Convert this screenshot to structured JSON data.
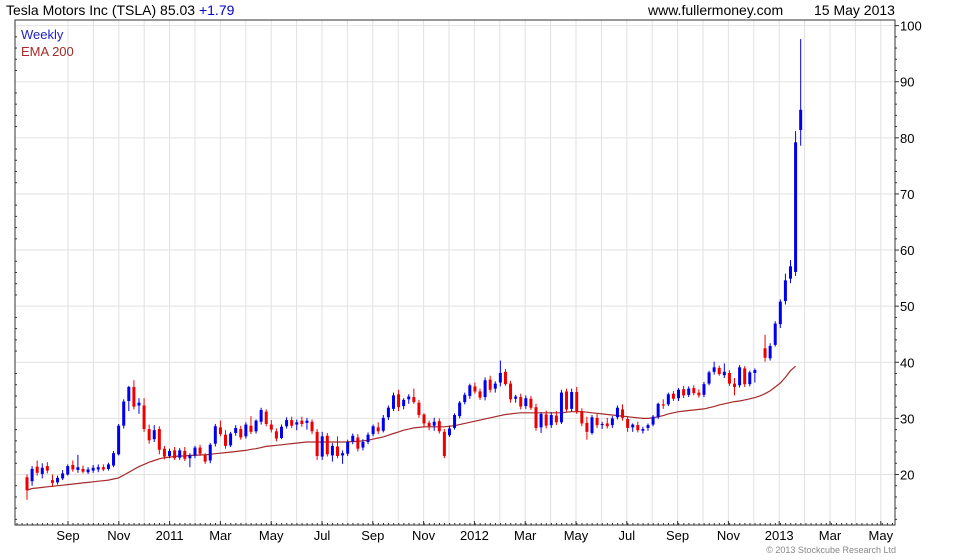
{
  "header": {
    "title": "Tesla Motors Inc (TSLA) 85.03",
    "change": "+1.79",
    "site": "www.fullermoney.com",
    "date": "15 May 2013"
  },
  "legend": {
    "period": "Weekly",
    "period_color": "#1f1fbf",
    "ema": "EMA 200",
    "ema_color": "#a52a2a"
  },
  "credit": "© 2013 Stockcube Research Ltd",
  "colors": {
    "up": "#0000ee",
    "down": "#ee0000",
    "ema": "#a52a2a",
    "grid": "#e2e2e2",
    "frame": "#333333"
  },
  "chart_data": {
    "type": "candlestick",
    "period": "weekly",
    "y_axis_side": "right",
    "ylim": [
      11,
      101
    ],
    "yticks": [
      20,
      30,
      40,
      50,
      60,
      70,
      80,
      90,
      100
    ],
    "grid": true,
    "legend_position": "top-left",
    "x_tick_labels": [
      "Sep",
      "Nov",
      "2011",
      "Mar",
      "May",
      "Jul",
      "Sep",
      "Nov",
      "2012",
      "Mar",
      "May",
      "Jul",
      "Sep",
      "Nov",
      "2013",
      "Mar",
      "May"
    ],
    "series": [
      {
        "name": "Weekly",
        "columns": [
          "open",
          "high",
          "low",
          "close"
        ],
        "values": [
          [
            19.5,
            20.0,
            15.5,
            17.2
          ],
          [
            18.8,
            21.5,
            18.0,
            21.0
          ],
          [
            21.4,
            22.5,
            19.8,
            20.3
          ],
          [
            20.1,
            22.0,
            19.3,
            21.2
          ],
          [
            21.5,
            22.2,
            20.2,
            20.7
          ],
          [
            19.0,
            20.0,
            17.8,
            18.5
          ],
          [
            18.6,
            19.8,
            18.2,
            19.4
          ],
          [
            19.3,
            20.8,
            19.0,
            20.2
          ],
          [
            20.0,
            21.8,
            19.8,
            21.5
          ],
          [
            21.7,
            22.5,
            20.5,
            20.9
          ],
          [
            20.8,
            23.5,
            20.3,
            21.3
          ],
          [
            21.0,
            21.6,
            20.2,
            20.5
          ],
          [
            20.4,
            21.3,
            20.1,
            20.9
          ],
          [
            20.7,
            21.7,
            20.3,
            21.2
          ],
          [
            20.9,
            21.8,
            20.4,
            21.3
          ],
          [
            21.3,
            21.8,
            20.6,
            20.9
          ],
          [
            21.0,
            22.1,
            20.7,
            21.8
          ],
          [
            21.6,
            24.2,
            21.3,
            23.8
          ],
          [
            23.6,
            29.0,
            23.4,
            28.7
          ],
          [
            28.7,
            33.4,
            28.2,
            33.0
          ],
          [
            33.1,
            35.8,
            31.3,
            35.6
          ],
          [
            35.6,
            36.8,
            31.6,
            32.1
          ],
          [
            32.3,
            33.6,
            30.8,
            32.8
          ],
          [
            32.3,
            33.6,
            27.6,
            28.1
          ],
          [
            28.1,
            28.9,
            25.5,
            26.1
          ],
          [
            26.3,
            28.8,
            25.8,
            27.9
          ],
          [
            28.1,
            28.6,
            23.6,
            24.4
          ],
          [
            24.6,
            25.1,
            22.7,
            23.2
          ],
          [
            23.3,
            24.6,
            22.9,
            24.2
          ],
          [
            24.3,
            24.9,
            22.6,
            22.9
          ],
          [
            23.0,
            24.7,
            22.6,
            24.3
          ],
          [
            24.2,
            24.9,
            22.4,
            22.8
          ],
          [
            22.9,
            23.8,
            21.3,
            23.4
          ],
          [
            23.4,
            25.1,
            22.9,
            24.8
          ],
          [
            24.8,
            25.3,
            23.3,
            23.7
          ],
          [
            23.4,
            23.8,
            21.9,
            22.3
          ],
          [
            22.5,
            25.6,
            22.0,
            25.3
          ],
          [
            25.5,
            29.0,
            25.0,
            28.6
          ],
          [
            28.4,
            29.6,
            26.8,
            27.2
          ],
          [
            27.1,
            27.9,
            24.6,
            25.1
          ],
          [
            25.2,
            27.6,
            24.9,
            27.3
          ],
          [
            27.4,
            28.8,
            26.9,
            28.3
          ],
          [
            28.1,
            28.7,
            26.2,
            26.6
          ],
          [
            26.8,
            29.3,
            26.4,
            28.9
          ],
          [
            28.7,
            30.4,
            27.2,
            27.6
          ],
          [
            27.7,
            29.8,
            27.3,
            29.6
          ],
          [
            29.4,
            31.9,
            28.9,
            31.5
          ],
          [
            31.2,
            31.6,
            28.6,
            29.0
          ],
          [
            28.9,
            29.7,
            27.5,
            28.0
          ],
          [
            27.7,
            28.2,
            25.9,
            26.4
          ],
          [
            26.5,
            28.9,
            26.3,
            28.5
          ],
          [
            28.6,
            30.2,
            28.2,
            29.7
          ],
          [
            29.7,
            30.3,
            28.3,
            28.7
          ],
          [
            28.9,
            29.8,
            27.9,
            29.3
          ],
          [
            29.6,
            30.3,
            28.5,
            29.0
          ],
          [
            29.2,
            30.1,
            28.0,
            29.6
          ],
          [
            29.4,
            29.8,
            27.2,
            27.7
          ],
          [
            27.6,
            28.1,
            22.6,
            23.3
          ],
          [
            23.2,
            27.6,
            22.6,
            26.8
          ],
          [
            26.9,
            27.4,
            23.2,
            23.6
          ],
          [
            23.4,
            25.6,
            22.3,
            25.1
          ],
          [
            25.0,
            26.8,
            22.9,
            23.3
          ],
          [
            23.4,
            24.3,
            21.9,
            23.8
          ],
          [
            23.7,
            26.2,
            23.3,
            25.8
          ],
          [
            25.9,
            27.3,
            25.4,
            26.9
          ],
          [
            26.6,
            27.2,
            24.1,
            24.6
          ],
          [
            24.8,
            26.3,
            24.3,
            25.8
          ],
          [
            25.8,
            27.5,
            25.4,
            27.1
          ],
          [
            27.2,
            28.9,
            26.8,
            28.6
          ],
          [
            28.4,
            29.3,
            27.2,
            27.7
          ],
          [
            27.8,
            30.6,
            27.5,
            30.1
          ],
          [
            30.2,
            32.3,
            29.7,
            31.9
          ],
          [
            31.7,
            34.6,
            31.3,
            34.1
          ],
          [
            34.3,
            35.1,
            31.3,
            32.0
          ],
          [
            32.2,
            33.6,
            31.6,
            33.3
          ],
          [
            33.4,
            34.3,
            32.6,
            33.9
          ],
          [
            33.8,
            35.3,
            32.6,
            32.9
          ],
          [
            32.8,
            33.3,
            30.1,
            30.6
          ],
          [
            30.7,
            30.9,
            28.4,
            29.1
          ],
          [
            29.2,
            29.6,
            27.9,
            28.6
          ],
          [
            28.7,
            30.1,
            27.8,
            29.4
          ],
          [
            29.5,
            30.0,
            27.3,
            27.7
          ],
          [
            27.6,
            28.1,
            22.9,
            23.3
          ],
          [
            27.0,
            28.7,
            26.7,
            28.2
          ],
          [
            28.3,
            30.9,
            28.0,
            30.6
          ],
          [
            30.4,
            33.1,
            30.0,
            32.8
          ],
          [
            32.9,
            34.6,
            32.5,
            34.2
          ],
          [
            34.0,
            36.2,
            33.5,
            35.9
          ],
          [
            35.7,
            36.4,
            34.4,
            34.8
          ],
          [
            34.8,
            35.3,
            33.3,
            33.7
          ],
          [
            33.8,
            37.3,
            33.2,
            36.8
          ],
          [
            36.9,
            37.6,
            34.6,
            35.1
          ],
          [
            35.3,
            36.6,
            34.6,
            36.2
          ],
          [
            36.4,
            40.3,
            35.7,
            38.1
          ],
          [
            38.3,
            38.8,
            35.8,
            36.1
          ],
          [
            36.2,
            36.7,
            32.8,
            33.4
          ],
          [
            33.5,
            34.2,
            32.8,
            33.9
          ],
          [
            33.8,
            34.4,
            31.6,
            32.1
          ],
          [
            32.2,
            34.1,
            31.7,
            33.6
          ],
          [
            33.5,
            34.0,
            31.5,
            31.9
          ],
          [
            32.0,
            32.6,
            27.8,
            28.3
          ],
          [
            28.4,
            31.1,
            27.4,
            30.8
          ],
          [
            30.7,
            31.4,
            28.2,
            28.7
          ],
          [
            28.8,
            31.1,
            28.3,
            30.6
          ],
          [
            30.5,
            31.3,
            28.8,
            29.3
          ],
          [
            29.3,
            35.1,
            29.0,
            34.6
          ],
          [
            34.8,
            35.3,
            31.2,
            31.6
          ],
          [
            31.7,
            35.3,
            31.2,
            34.7
          ],
          [
            34.7,
            35.6,
            30.8,
            31.2
          ],
          [
            31.3,
            31.8,
            28.6,
            29.1
          ],
          [
            29.2,
            30.3,
            26.2,
            27.6
          ],
          [
            27.4,
            30.6,
            27.1,
            30.2
          ],
          [
            30.1,
            30.8,
            28.3,
            28.8
          ],
          [
            28.8,
            29.4,
            28.1,
            29.0
          ],
          [
            29.1,
            30.1,
            28.2,
            28.6
          ],
          [
            28.8,
            30.4,
            28.3,
            30.0
          ],
          [
            30.2,
            32.3,
            29.8,
            31.9
          ],
          [
            31.6,
            32.5,
            29.6,
            30.1
          ],
          [
            29.9,
            30.4,
            27.6,
            28.3
          ],
          [
            28.4,
            29.1,
            27.6,
            28.9
          ],
          [
            28.8,
            29.4,
            27.5,
            27.9
          ],
          [
            27.8,
            28.5,
            27.3,
            28.1
          ],
          [
            28.3,
            29.1,
            27.8,
            28.8
          ],
          [
            28.9,
            30.6,
            28.6,
            30.3
          ],
          [
            30.2,
            32.8,
            29.9,
            32.6
          ],
          [
            32.5,
            33.4,
            31.7,
            32.3
          ],
          [
            32.5,
            34.6,
            32.2,
            34.3
          ],
          [
            34.4,
            34.9,
            33.1,
            33.5
          ],
          [
            33.6,
            35.4,
            33.1,
            35.1
          ],
          [
            35.2,
            35.8,
            33.6,
            34.1
          ],
          [
            34.2,
            35.7,
            33.8,
            35.3
          ],
          [
            35.4,
            35.9,
            34.1,
            34.5
          ],
          [
            34.6,
            35.2,
            33.7,
            34.1
          ],
          [
            34.2,
            36.5,
            33.8,
            36.1
          ],
          [
            36.2,
            38.5,
            35.9,
            38.2
          ],
          [
            38.3,
            40.1,
            37.8,
            39.1
          ],
          [
            39.0,
            39.4,
            37.6,
            37.9
          ],
          [
            37.7,
            39.8,
            37.2,
            38.3
          ],
          [
            38.1,
            38.6,
            35.8,
            36.2
          ],
          [
            36.2,
            37.2,
            34.1,
            35.6
          ],
          [
            35.9,
            39.5,
            35.5,
            39.1
          ],
          [
            38.9,
            39.3,
            35.6,
            36.1
          ],
          [
            36.1,
            38.5,
            35.7,
            38.2
          ],
          [
            38.1,
            38.9,
            36.4,
            38.6
          ],
          null,
          [
            42.5,
            44.9,
            40.1,
            40.8
          ],
          [
            40.7,
            43.4,
            40.3,
            42.9
          ],
          [
            43.1,
            47.3,
            42.8,
            46.9
          ],
          [
            46.8,
            51.2,
            46.1,
            50.8
          ],
          [
            50.9,
            55.8,
            50.3,
            54.6
          ],
          [
            54.9,
            58.2,
            54.1,
            57.1
          ],
          [
            56.1,
            81.2,
            55.4,
            79.2
          ],
          [
            81.4,
            97.6,
            78.6,
            85.0
          ]
        ]
      },
      {
        "name": "EMA 200",
        "values": [
          17.2,
          17.5,
          17.6,
          17.7,
          17.8,
          17.9,
          18.0,
          18.1,
          18.2,
          18.3,
          18.4,
          18.5,
          18.6,
          18.7,
          18.8,
          18.9,
          19.0,
          19.2,
          19.4,
          19.9,
          20.4,
          20.9,
          21.4,
          21.8,
          22.2,
          22.5,
          22.8,
          23.0,
          23.1,
          23.2,
          23.3,
          23.3,
          23.4,
          23.4,
          23.5,
          23.5,
          23.6,
          23.7,
          23.8,
          23.9,
          24.0,
          24.1,
          24.2,
          24.3,
          24.5,
          24.6,
          24.8,
          25.0,
          25.1,
          25.2,
          25.3,
          25.4,
          25.5,
          25.6,
          25.7,
          25.8,
          25.8,
          25.8,
          25.8,
          25.8,
          25.8,
          25.8,
          25.8,
          25.8,
          25.9,
          25.9,
          26.0,
          26.1,
          26.3,
          26.5,
          26.7,
          27.0,
          27.3,
          27.6,
          27.9,
          28.1,
          28.3,
          28.4,
          28.5,
          28.5,
          28.5,
          28.5,
          28.5,
          28.6,
          28.7,
          28.9,
          29.1,
          29.3,
          29.5,
          29.7,
          29.9,
          30.1,
          30.3,
          30.5,
          30.7,
          30.8,
          30.9,
          31.0,
          31.0,
          31.0,
          31.0,
          31.0,
          31.0,
          31.0,
          31.0,
          31.0,
          31.1,
          31.2,
          31.2,
          31.2,
          31.1,
          31.0,
          30.9,
          30.8,
          30.7,
          30.6,
          30.5,
          30.4,
          30.3,
          30.2,
          30.1,
          30.0,
          30.0,
          30.1,
          30.3,
          30.5,
          30.8,
          31.0,
          31.2,
          31.3,
          31.4,
          31.5,
          31.6,
          31.7,
          31.9,
          32.1,
          32.4,
          32.6,
          32.8,
          33.0,
          33.1,
          33.3,
          33.5,
          33.7,
          34.0,
          34.4,
          34.9,
          35.6,
          36.3,
          37.3,
          38.5,
          39.3
        ]
      }
    ]
  }
}
